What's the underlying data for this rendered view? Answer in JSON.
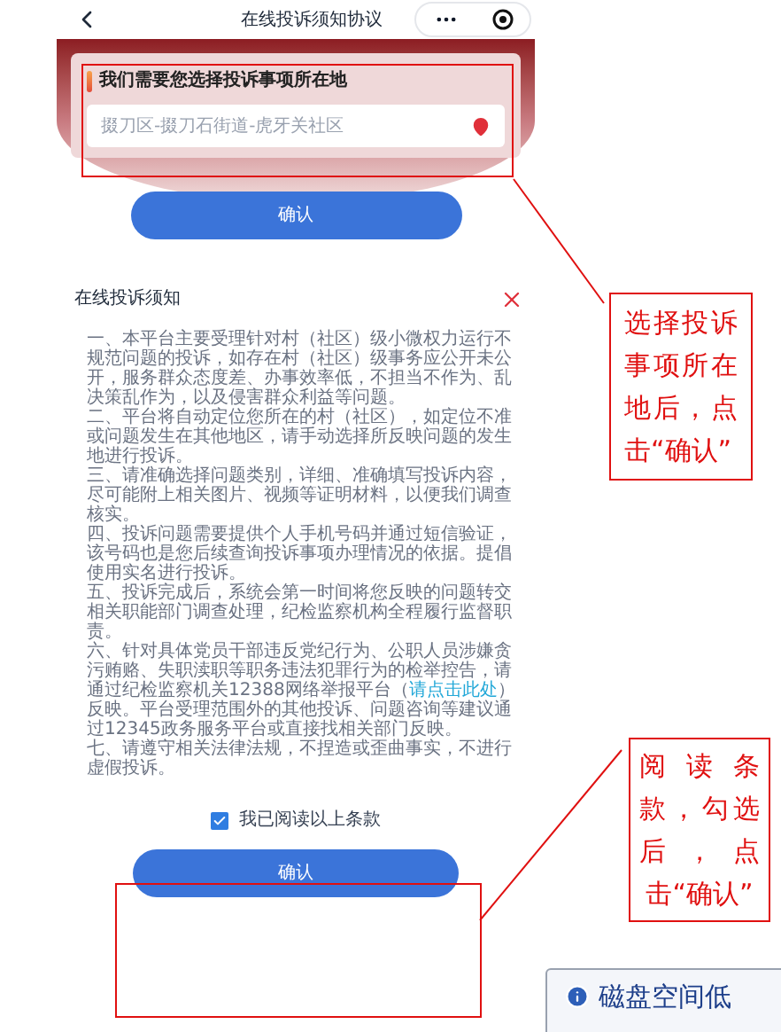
{
  "nav": {
    "title": "在线投诉须知协议"
  },
  "location_card": {
    "title": "我们需要您选择投诉事项所在地",
    "value": "掇刀区-掇刀石街道-虎牙关社区"
  },
  "top_button": "确认",
  "notice": {
    "title": "在线投诉须知",
    "paragraphs": [
      {
        "kind": "plain",
        "text": "一、本平台主要受理针对村（社区）级小微权力运行不规范问题的投诉，如存在村（社区）级事务应公开未公开，服务群众态度差、办事效率低，不担当不作为、乱决策乱作为，以及侵害群众利益等问题。"
      },
      {
        "kind": "plain",
        "text": "二、平台将自动定位您所在的村（社区），如定位不准或问题发生在其他地区，请手动选择所反映问题的发生地进行投诉。"
      },
      {
        "kind": "plain",
        "text": "三、请准确选择问题类别，详细、准确填写投诉内容，尽可能附上相关图片、视频等证明材料，以便我们调查核实。"
      },
      {
        "kind": "plain",
        "text": "四、投诉问题需要提供个人手机号码并通过短信验证，该号码也是您后续查询投诉事项办理情况的依据。提倡使用实名进行投诉。"
      },
      {
        "kind": "plain",
        "text": "五、投诉完成后，系统会第一时间将您反映的问题转交相关职能部门调查处理，纪检监察机构全程履行监督职责。"
      },
      {
        "kind": "with_link",
        "before": "六、针对具体党员干部违反党纪行为、公职人员涉嫌贪污贿赂、失职渎职等职务违法犯罪行为的检举控告，请通过纪检监察机关12388网络举报平台（",
        "link": "请点击此处",
        "after": "）反映。平台受理范围外的其他投诉、问题咨询等建议通过12345政务服务平台或直接找相关部门反映。"
      },
      {
        "kind": "plain",
        "text": "七、请遵守相关法律法规，不捏造或歪曲事实，不进行虚假投诉。"
      }
    ]
  },
  "agreement": {
    "label": "我已阅读以上条款",
    "checked": true
  },
  "bottom_button": "确认",
  "annotations": [
    {
      "text": "选择投诉事项所在地后，点击“确认”"
    },
    {
      "text": "阅读条款，勾选后，点击“确认”"
    }
  ],
  "notification": {
    "title": "磁盘空间低"
  }
}
